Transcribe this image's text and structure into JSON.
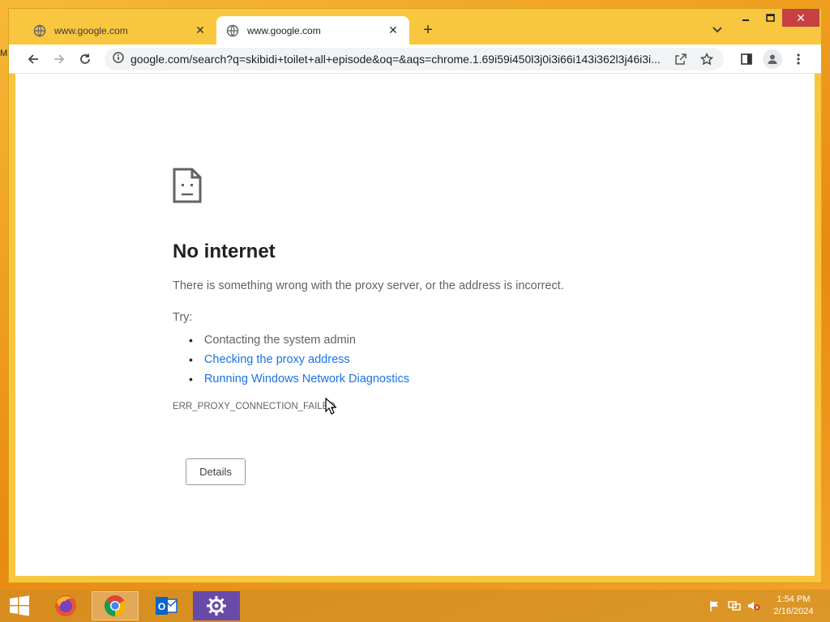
{
  "browser": {
    "tabs": [
      {
        "label": "www.google.com",
        "active": false
      },
      {
        "label": "www.google.com",
        "active": true
      }
    ],
    "url": "google.com/search?q=skibidi+toilet+all+episode&oq=&aqs=chrome.1.69i59i450l3j0i3i66i143i362l3j46i3i..."
  },
  "error_page": {
    "title": "No internet",
    "description": "There is something wrong with the proxy server, or the address is incorrect.",
    "try_label": "Try:",
    "suggestions": [
      "Contacting the system admin",
      "Checking the proxy address",
      "Running Windows Network Diagnostics"
    ],
    "error_code": "ERR_PROXY_CONNECTION_FAILED",
    "details_button": "Details"
  },
  "taskbar": {
    "apps": [
      "firefox-icon",
      "chrome-icon",
      "outlook-icon",
      "settings-icon"
    ],
    "time": "1:54 PM",
    "date": "2/16/2024"
  },
  "colors": {
    "accent_link": "#1a73e8",
    "window_frame": "#f8c63f",
    "close_button": "#c74042"
  }
}
